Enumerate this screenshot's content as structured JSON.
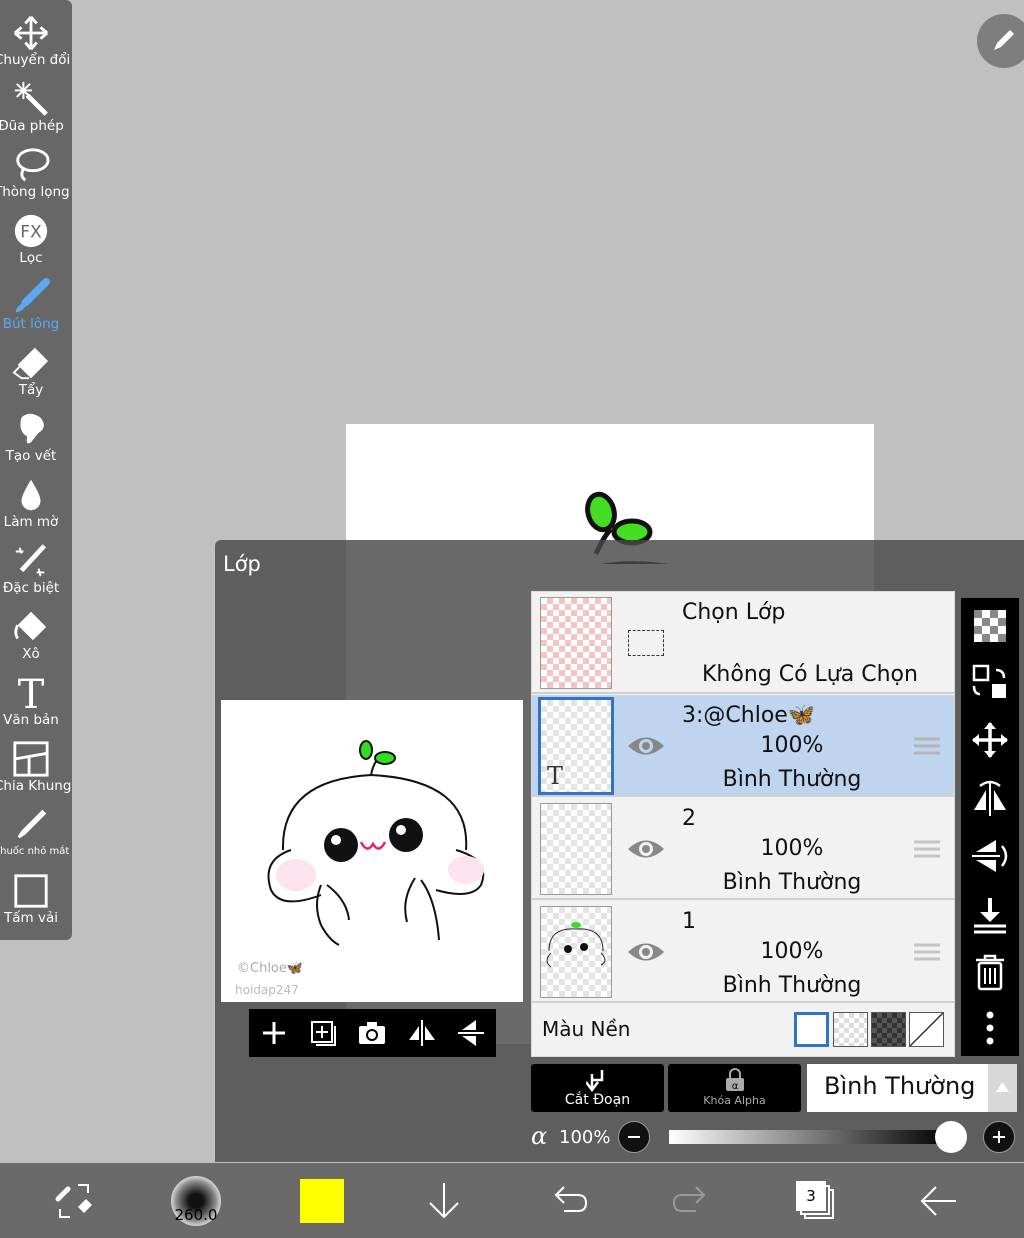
{
  "toolbar": {
    "items": [
      {
        "label": "Chuyển đổi",
        "icon": "move-icon"
      },
      {
        "label": "Đũa phép",
        "icon": "magic-wand-icon"
      },
      {
        "label": "Thòng lọng",
        "icon": "lasso-icon"
      },
      {
        "label": "Lọc",
        "icon": "fx-filter-icon"
      },
      {
        "label": "Bút lông",
        "icon": "brush-icon",
        "active": true
      },
      {
        "label": "Tẩy",
        "icon": "eraser-icon"
      },
      {
        "label": "Tạo vết",
        "icon": "smudge-icon"
      },
      {
        "label": "Làm mờ",
        "icon": "blur-drop-icon"
      },
      {
        "label": "Đặc biệt",
        "icon": "special-pen-icon"
      },
      {
        "label": "Xô",
        "icon": "bucket-icon"
      },
      {
        "label": "Văn bản",
        "icon": "text-icon"
      },
      {
        "label": "Chia Khung",
        "icon": "frame-divider-icon"
      },
      {
        "label": "Thuốc nhỏ mắt",
        "icon": "eyedropper-icon"
      },
      {
        "label": "Tấm vải",
        "icon": "canvas-icon"
      }
    ],
    "active_color": "#5aa9f2"
  },
  "layer_panel": {
    "title": "Lớp",
    "preview": {
      "watermark_line1": "©Chloe🦋",
      "watermark_line2": "hoidap247"
    },
    "selection_row": {
      "title": "Chọn Lớp",
      "status": "Không Có Lựa Chọn"
    },
    "layers": [
      {
        "name": "3:@Chloe🦋",
        "opacity": "100%",
        "mode": "Bình Thường",
        "selected": true,
        "thumb_badge": "T"
      },
      {
        "name": "2",
        "opacity": "100%",
        "mode": "Bình Thường",
        "selected": false
      },
      {
        "name": "1",
        "opacity": "100%",
        "mode": "Bình Thường",
        "selected": false
      }
    ],
    "background": {
      "label": "Màu Nền",
      "options": [
        "white",
        "transparent-checker",
        "dark-checker",
        "none"
      ],
      "selected": "white"
    },
    "cut_button": "Cắt Đoạn",
    "alpha_lock_button": "Khóa Alpha",
    "blend_mode": "Bình Thường",
    "opacity": {
      "symbol": "α",
      "value": "100%"
    }
  },
  "bottom_bar": {
    "brush_size": "260.0",
    "current_color": "#ffff00",
    "layer_count": "3"
  },
  "colors": {
    "canvas_bg": "#c0c0c0",
    "panel_bg": "#676767",
    "selected_layer": "#bed4ef",
    "selected_border": "#2f74c8",
    "sprout_green": "#33dd22"
  }
}
